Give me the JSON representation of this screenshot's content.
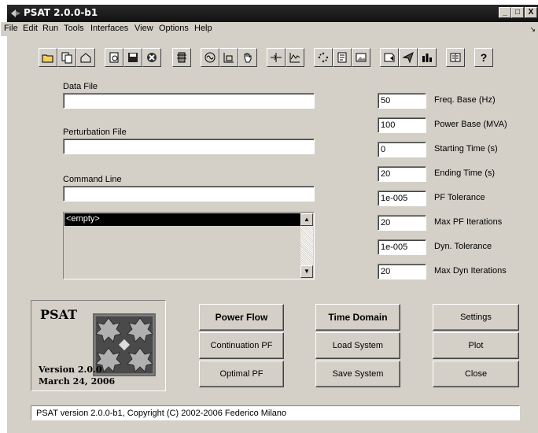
{
  "window": {
    "title": "PSAT 2.0.0-b1",
    "controls": {
      "minimize": "_",
      "maximize": "□",
      "close": "X"
    }
  },
  "menubar": {
    "items": [
      "File",
      "Edit",
      "Run",
      "Tools",
      "Interfaces",
      "View",
      "Options",
      "Help"
    ],
    "arrow": "↘"
  },
  "toolbar": {
    "icons": [
      "open-folder-icon",
      "copy-icon",
      "folder-tree-icon",
      "preview-icon",
      "save-icon",
      "stop-icon",
      "tool-icon",
      "generator-icon",
      "graph-icon",
      "hand-icon",
      "bus-icon",
      "waveform-icon",
      "scatter-icon",
      "report-icon",
      "image-icon",
      "script-icon",
      "run-icon",
      "bar-chart-icon",
      "book-icon",
      "help-icon"
    ]
  },
  "fields": {
    "data_file": {
      "label": "Data File",
      "value": ""
    },
    "perturbation_file": {
      "label": "Perturbation File",
      "value": ""
    },
    "command_line": {
      "label": "Command Line",
      "value": ""
    }
  },
  "listbox": {
    "items": [
      "<empty>"
    ]
  },
  "parameters": [
    {
      "value": "50",
      "label": "Freq. Base (Hz)"
    },
    {
      "value": "100",
      "label": "Power Base (MVA)"
    },
    {
      "value": "0",
      "label": "Starting Time (s)"
    },
    {
      "value": "20",
      "label": "Ending Time (s)"
    },
    {
      "value": "1e-005",
      "label": "PF Tolerance"
    },
    {
      "value": "20",
      "label": "Max PF Iterations"
    },
    {
      "value": "1e-005",
      "label": "Dyn. Tolerance"
    },
    {
      "value": "20",
      "label": "Max Dyn Iterations"
    }
  ],
  "logo": {
    "title": "PSAT",
    "version": "Version 2.0.0",
    "date": "March 24,  2006"
  },
  "buttons": {
    "power_flow": "Power Flow",
    "continuation_pf": "Continuation PF",
    "optimal_pf": "Optimal PF",
    "time_domain": "Time Domain",
    "load_system": "Load System",
    "save_system": "Save System",
    "settings": "Settings",
    "plot": "Plot",
    "close": "Close"
  },
  "status": "PSAT version 2.0.0-b1, Copyright (C) 2002-2006 Federico Milano"
}
